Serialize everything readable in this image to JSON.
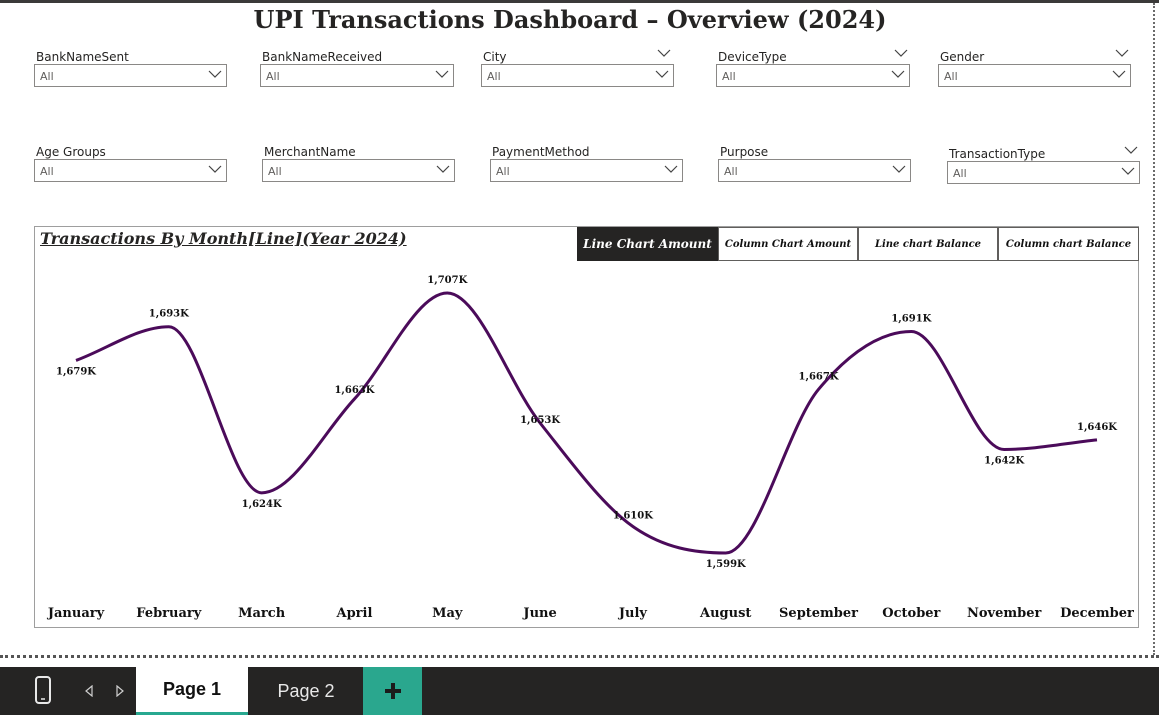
{
  "title": "UPI Transactions Dashboard – Overview (2024)",
  "filters_row1": [
    {
      "label": "BankNameSent",
      "value": "All"
    },
    {
      "label": "BankNameReceived",
      "value": "All"
    },
    {
      "label": "City",
      "value": "All"
    },
    {
      "label": "DeviceType",
      "value": "All"
    },
    {
      "label": "Gender",
      "value": "All"
    }
  ],
  "filters_row2": [
    {
      "label": "Age Groups",
      "value": "All"
    },
    {
      "label": "MerchantName",
      "value": "All"
    },
    {
      "label": "PaymentMethod",
      "value": "All"
    },
    {
      "label": "Purpose",
      "value": "All"
    },
    {
      "label": "TransactionType",
      "value": "All"
    }
  ],
  "chart_toggle": {
    "line_amount": "Line Chart Amount",
    "column_amount": "Column Chart Amount",
    "line_balance": "Line chart Balance",
    "column_balance": "Column chart Balance",
    "active": "Line Chart Amount"
  },
  "chart_data": {
    "type": "line",
    "title": "Transactions By Month[Line](Year 2024)",
    "categories": [
      "January",
      "February",
      "March",
      "April",
      "May",
      "June",
      "July",
      "August",
      "September",
      "October",
      "November",
      "December"
    ],
    "values": [
      1679,
      1693,
      1624,
      1663,
      1707,
      1653,
      1610,
      1599,
      1667,
      1691,
      1642,
      1646
    ],
    "data_labels": [
      "1,679K",
      "1,693K",
      "1,624K",
      "1,663K",
      "1,707K",
      "1,653K",
      "1,610K",
      "1,599K",
      "1,667K",
      "1,691K",
      "1,642K",
      "1,646K"
    ],
    "xlabel": "",
    "ylabel": "",
    "line_color": "#4b0b5a",
    "grid": false,
    "legend": "none"
  },
  "pages": {
    "page1": "Page 1",
    "page2": "Page 2",
    "active": "Page 1"
  },
  "icons": {
    "phone": "mobile-view-icon",
    "prev": "prev-page-icon",
    "next": "next-page-icon",
    "add": "add-page-icon"
  }
}
